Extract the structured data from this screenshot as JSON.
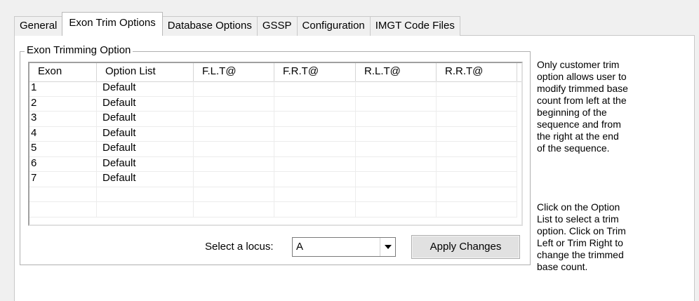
{
  "tabs": [
    {
      "label": "General",
      "active": false
    },
    {
      "label": "Exon Trim Options",
      "active": true
    },
    {
      "label": "Database Options",
      "active": false
    },
    {
      "label": "GSSP",
      "active": false
    },
    {
      "label": "Configuration",
      "active": false
    },
    {
      "label": "IMGT Code Files",
      "active": false
    }
  ],
  "group": {
    "title": "Exon Trimming Option"
  },
  "grid": {
    "columns": [
      "Exon",
      "Option List",
      "F.L.T@",
      "F.R.T@",
      "R.L.T@",
      "R.R.T@"
    ],
    "rows": [
      [
        "1",
        "Default",
        "",
        "",
        "",
        ""
      ],
      [
        "2",
        "Default",
        "",
        "",
        "",
        ""
      ],
      [
        "3",
        "Default",
        "",
        "",
        "",
        ""
      ],
      [
        "4",
        "Default",
        "",
        "",
        "",
        ""
      ],
      [
        "5",
        "Default",
        "",
        "",
        "",
        ""
      ],
      [
        "6",
        "Default",
        "",
        "",
        "",
        ""
      ],
      [
        "7",
        "Default",
        "",
        "",
        "",
        ""
      ],
      [
        "",
        "",
        "",
        "",
        "",
        ""
      ],
      [
        "",
        "",
        "",
        "",
        "",
        ""
      ]
    ]
  },
  "locus": {
    "label": "Select a locus:",
    "value": "A"
  },
  "apply_button": "Apply Changes",
  "help": {
    "text1": "Only customer trim\noption allows user to\nmodify trimmed base\ncount from left at the\nbeginning of the\nsequence and from\nthe right at the end\nof the sequence.",
    "text2": "Click on the Option\nList to select a trim\noption. Click on Trim\nLeft or Trim Right to\nchange the trimmed\nbase count."
  }
}
